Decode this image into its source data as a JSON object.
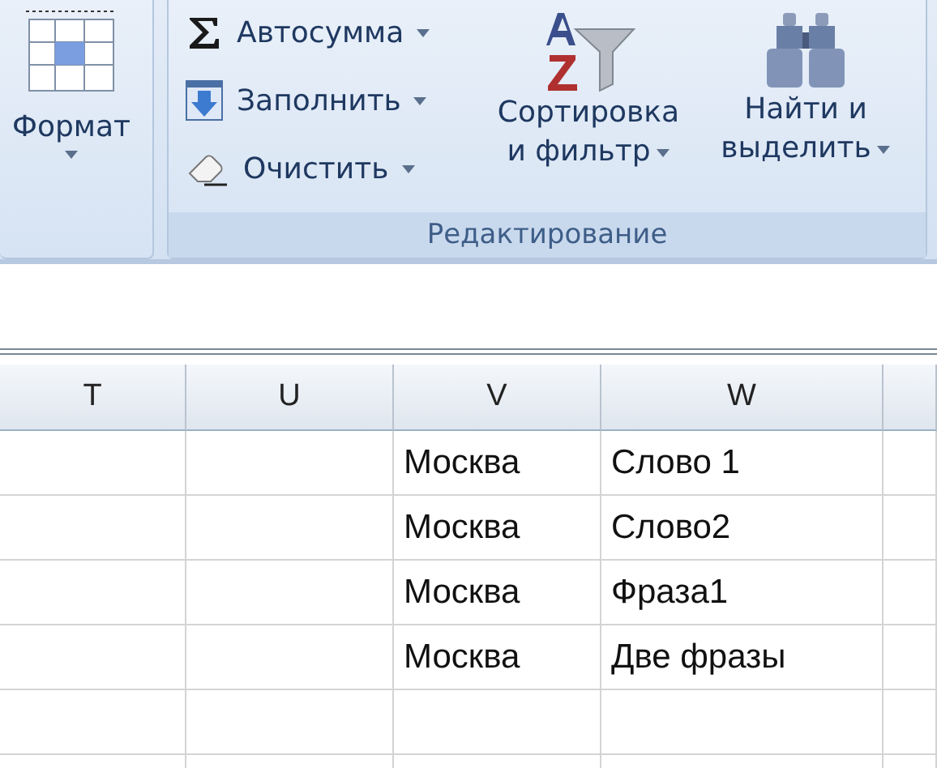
{
  "ribbon": {
    "format_button": {
      "label": "Формат"
    },
    "editing_group": {
      "title": "Редактирование",
      "small_buttons": [
        {
          "label": "Автосумма"
        },
        {
          "label": "Заполнить"
        },
        {
          "label": "Очистить"
        }
      ],
      "large_buttons": [
        {
          "lines": [
            "Сортировка",
            "и фильтр"
          ]
        },
        {
          "lines": [
            "Найти и",
            "выделить"
          ]
        }
      ]
    }
  },
  "sheet": {
    "columns": [
      "T",
      "U",
      "V",
      "W"
    ],
    "rows": [
      {
        "v": "Москва",
        "w": "Слово 1"
      },
      {
        "v": "Москва",
        "w": "Слово2"
      },
      {
        "v": "Москва",
        "w": "Фраза1"
      },
      {
        "v": "Москва",
        "w": "Две фразы"
      }
    ]
  }
}
